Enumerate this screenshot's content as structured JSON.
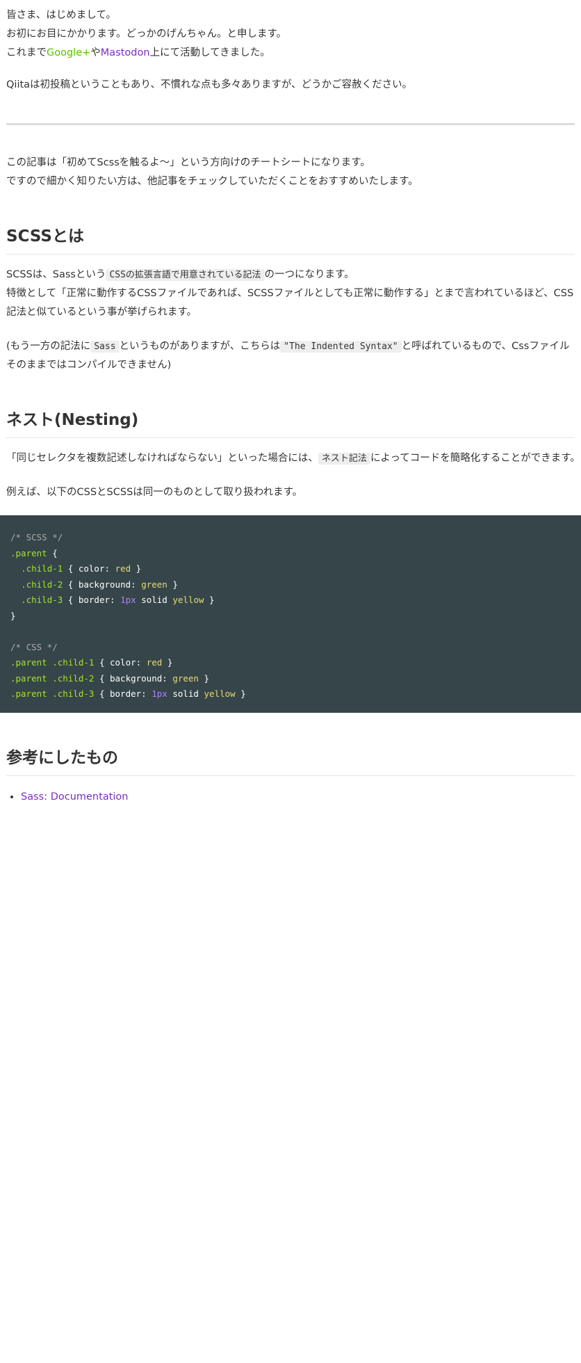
{
  "intro": {
    "line1": "皆さま、はじめまして。",
    "line2": "お初にお目にかかります。どっかのげんちゃん。と申します。",
    "line3_prefix": "これまで",
    "line3_link1": "Google+",
    "line3_mid": "や",
    "line3_link2": "Mastodon",
    "line3_suffix": "上にて活動してきました。",
    "para2": "Qiitaは初投稿ということもあり、不慣れな点も多々ありますが、どうかご容赦ください。"
  },
  "overview": {
    "line1": "この記事は「初めてScssを触るよ～」という方向けのチートシートになります。",
    "line2": "ですので細かく知りたい方は、他記事をチェックしていただくことをおすすめいたします。"
  },
  "section_scss": {
    "heading": "SCSSとは",
    "p1_prefix": "SCSSは、Sassという",
    "p1_code": "CSSの拡張言語で用意されている記法",
    "p1_suffix": "の一つになります。",
    "p1_line2": "特徴として「正常に動作するCSSファイルであれば、SCSSファイルとしても正常に動作する」とまで言われているほど、CSS記法と似ているという事が挙げられます。",
    "p2_prefix": "(もう一方の記法に",
    "p2_code1": "Sass",
    "p2_mid": "というものがありますが、こちらは",
    "p2_code2": "\"The Indented Syntax\"",
    "p2_suffix": "と呼ばれているもので、Cssファイルそのままではコンパイルできません)"
  },
  "section_nesting": {
    "heading": "ネスト(Nesting)",
    "p1_prefix": "「同じセレクタを複数記述しなければならない」といった場合には、",
    "p1_code": "ネスト記法",
    "p1_suffix": "によってコードを簡略化することができます。",
    "p2": "例えば、以下のCSSとSCSSは同一のものとして取り扱われます。",
    "code": {
      "scss_comment": "/* SCSS */",
      "parent_open": ".parent",
      "brace_open": " {",
      "child1_sel": ".child-1",
      "child2_sel": ".child-2",
      "child3_sel": ".child-3",
      "prop_color": "color",
      "prop_background": "background",
      "prop_border": "border",
      "val_red": "red",
      "val_green": "green",
      "val_1px": "1px",
      "val_solid": "solid",
      "val_yellow": "yellow",
      "brace_close": "}",
      "css_comment": "/* CSS */",
      "css1_sel": ".parent .child-1",
      "css2_sel": ".parent .child-2",
      "css3_sel": ".parent .child-3"
    }
  },
  "section_refs": {
    "heading": "参考にしたもの",
    "items": [
      "Sass: Documentation"
    ]
  },
  "colors": {
    "link_green": "#55c500",
    "link_purple": "#7b2dbd",
    "code_bg": "#364549",
    "text": "#333333"
  }
}
